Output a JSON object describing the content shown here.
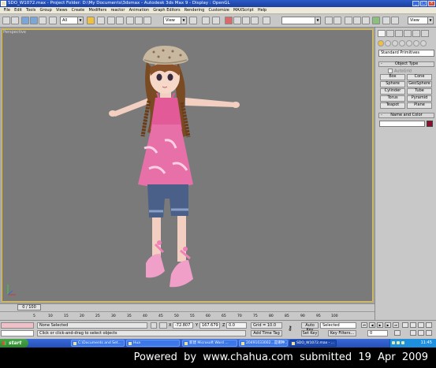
{
  "window": {
    "title": "SDO_W1072.max   - Project Folder: D:\\My Documents\\3dsmax   - Autodesk 3ds Max 9   - Display : OpenGL"
  },
  "menu": [
    "File",
    "Edit",
    "Tools",
    "Group",
    "Views",
    "Create",
    "Modifiers",
    "reactor",
    "Animation",
    "Graph Editors",
    "Rendering",
    "Customize",
    "MAXScript",
    "Help"
  ],
  "toolbar": {
    "selection_filter": "All",
    "reference_coord": "View",
    "right_view": "View"
  },
  "viewport": {
    "label": "Perspective"
  },
  "command_panel": {
    "category": "Standard Primitives",
    "object_type_header": "Object Type",
    "autogrid": "AutoGrid",
    "primitives": [
      "Box",
      "Cone",
      "Sphere",
      "GeoSphere",
      "Cylinder",
      "Tube",
      "Torus",
      "Pyramid",
      "Teapot",
      "Plane"
    ],
    "name_color_header": "Name and Color",
    "object_color": "#8a1030"
  },
  "time": {
    "slider": "0 / 100",
    "ticks": [
      "0",
      "5",
      "10",
      "15",
      "20",
      "25",
      "30",
      "35",
      "40",
      "45",
      "50",
      "55",
      "60",
      "65",
      "70",
      "75",
      "80",
      "85",
      "90",
      "95",
      "100"
    ]
  },
  "status": {
    "selection": "None Selected",
    "prompt": "Click or click-and-drag to select objects",
    "x_label": "X",
    "x_value": "-72.807",
    "y_label": "Y",
    "y_value": "167.679",
    "z_label": "Z",
    "z_value": "0.0",
    "grid": "Grid = 10.0",
    "add_time_tag": "Add Time Tag",
    "auto_key": "Auto Key",
    "auto_key_mode": "Selected",
    "set_key": "Set Key",
    "key_filters": "Key Filters...",
    "frame": "0"
  },
  "taskbar": {
    "start": "start",
    "tasks": [
      "C:\\Documents and Set...",
      "Hua",
      "新建 Microsoft Word ...",
      "20491033002...是哪种...",
      "SDO_W1072.max - ..."
    ],
    "clock": "11:45"
  },
  "watermark": "Powered  by  www.chahua.com  submitted  19  Apr  2009"
}
